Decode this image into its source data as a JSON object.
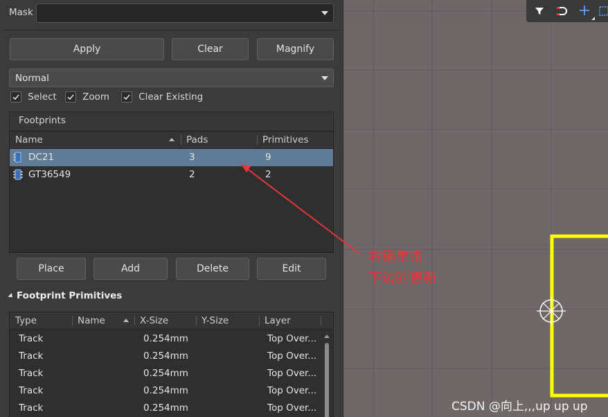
{
  "filter": {
    "mask_label": "Mask",
    "mask_value": "",
    "apply_label": "Apply",
    "clear_label": "Clear",
    "magnify_label": "Magnify",
    "mode_value": "Normal",
    "select_label": "Select",
    "zoom_label": "Zoom",
    "clear_existing_label": "Clear Existing",
    "select_checked": true,
    "zoom_checked": true,
    "clear_existing_checked": true
  },
  "footprints": {
    "title": "Footprints",
    "columns": [
      "Name",
      "Pads",
      "Primitives"
    ],
    "rows": [
      {
        "name": "DC21",
        "pads": "3",
        "primitives": "9",
        "icon": "footprint-chip-icon",
        "selected": true
      },
      {
        "name": "GT36549",
        "pads": "2",
        "primitives": "2",
        "icon": "footprint-chip-icon",
        "selected": false
      }
    ],
    "buttons": {
      "place": "Place",
      "add": "Add",
      "delete": "Delete",
      "edit": "Edit"
    }
  },
  "primitives": {
    "title": "Footprint Primitives",
    "columns": [
      "Type",
      "Name",
      "X-Size",
      "Y-Size",
      "Layer"
    ],
    "rows": [
      {
        "type": "Track",
        "name": "",
        "xsize": "0.254mm",
        "ysize": "",
        "layer": "Top Over..."
      },
      {
        "type": "Track",
        "name": "",
        "xsize": "0.254mm",
        "ysize": "",
        "layer": "Top Over..."
      },
      {
        "type": "Track",
        "name": "",
        "xsize": "0.254mm",
        "ysize": "",
        "layer": "Top Over..."
      },
      {
        "type": "Track",
        "name": "",
        "xsize": "0.254mm",
        "ysize": "",
        "layer": "Top Over..."
      },
      {
        "type": "Track",
        "name": "",
        "xsize": "0.254mm",
        "ysize": "",
        "layer": "Top Over..."
      }
    ]
  },
  "annotation": {
    "line1": "右键单击",
    "line2": "下边的更新",
    "color": "#e8363a"
  },
  "watermark": "CSDN @向上,,,up up up",
  "toolbar_icons": [
    "filter-icon",
    "snap-magnet-icon",
    "crosshair-icon",
    "select-rect-icon"
  ],
  "colors": {
    "panel_bg": "#3b3b3b",
    "canvas_bg": "#6f6868",
    "selection": "#5f7b96",
    "outline_yellow": "#ffff00"
  }
}
